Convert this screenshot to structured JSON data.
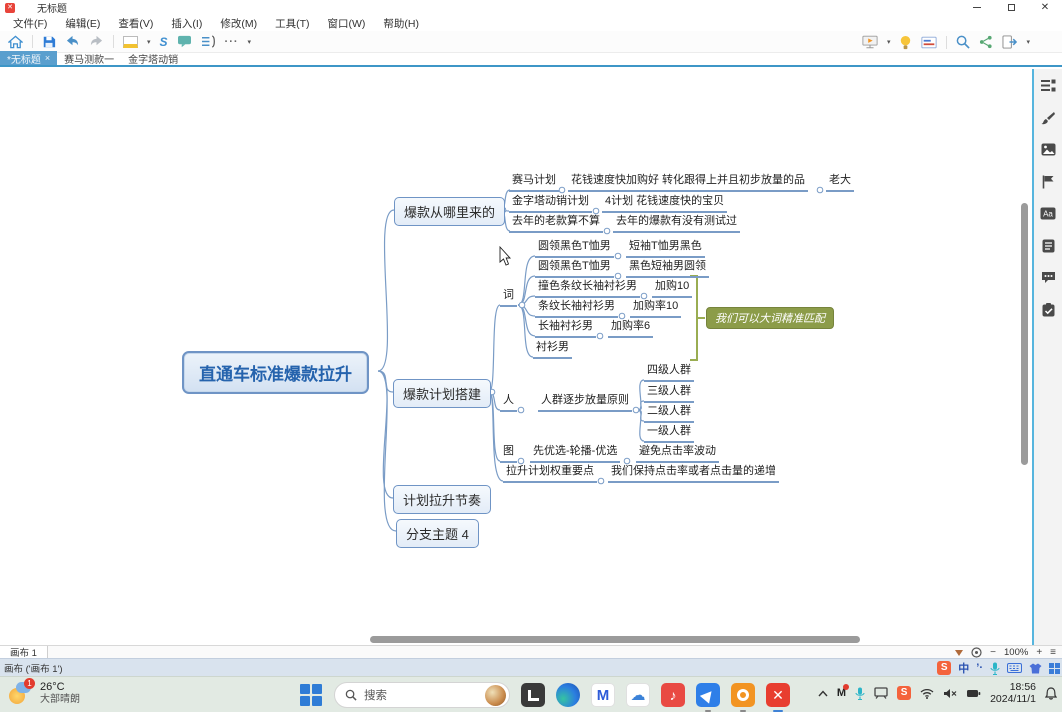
{
  "window": {
    "title": "无标题"
  },
  "menubar": {
    "items": [
      "文件(F)",
      "编辑(E)",
      "查看(V)",
      "插入(I)",
      "修改(M)",
      "工具(T)",
      "窗口(W)",
      "帮助(H)"
    ]
  },
  "doc_tabs": {
    "active_label": "*无标题",
    "close": "×",
    "tab2": "赛马测款一",
    "tab3": "金字塔动销"
  },
  "glyphs": {
    "more": "···",
    "caret": "▾",
    "flag": "⚑",
    "font_sample": "Aa",
    "lang": "中",
    "punct": "’·",
    "fit": "≡",
    "minus": "−",
    "plus": "+",
    "chevron_up": "⌃",
    "app_letter": "M",
    "note": "♪",
    "cross": "✕",
    "cloud": "☁",
    "s_relation": "S"
  },
  "mindmap": {
    "central": "直通车标准爆款拉升",
    "b1": {
      "label": "爆款从哪里来的",
      "r1a": "赛马计划",
      "r1b": "花钱速度快加购好 转化跟得上并且初步放量的品",
      "r1c": "老大",
      "r2a": "金字塔动销计划",
      "r2b": "4计划 花钱速度快的宝贝",
      "r3a": "去年的老款算不算",
      "r3b": "去年的爆款有没有测试过"
    },
    "b2": {
      "label": "爆款计划搭建",
      "word": {
        "label": "词",
        "i1a": "圆领黑色T恤男",
        "i1b": "短袖T恤男黑色",
        "i2a": "圆领黑色T恤男",
        "i2b": "黑色短袖男圆领",
        "i3a": "撞色条纹长袖衬衫男",
        "i3b": "加购10",
        "i4a": "条纹长袖衬衫男",
        "i4b": "加购率10",
        "i5a": "长袖衬衫男",
        "i5b": "加购率6",
        "i6a": "衬衫男",
        "callout": "我们可以大词精准匹配"
      },
      "people": {
        "label": "人",
        "principle": "人群逐步放量原则",
        "g4": "四级人群",
        "g3": "三级人群",
        "g2": "二级人群",
        "g1": "一级人群"
      },
      "pic": {
        "label": "图",
        "a": "先优选-轮播-优选",
        "b": "避免点击率波动"
      },
      "weight": {
        "a": "拉升计划权重要点",
        "b": "我们保持点击率或者点击量的递增"
      }
    },
    "b3": {
      "label": "计划拉升节奏"
    },
    "b4": {
      "label": "分支主题 4"
    }
  },
  "canvas_tab": {
    "label": "画布 1",
    "zoom_level": "100%"
  },
  "statusbar": {
    "text": "画布 ('画布 1')"
  },
  "taskbar": {
    "weather": {
      "temp": "26°C",
      "desc": "大部晴朗",
      "badge": "1"
    },
    "search": {
      "placeholder": "搜索"
    },
    "tray": {
      "time": "18:56",
      "date": "2024/11/1"
    }
  }
}
